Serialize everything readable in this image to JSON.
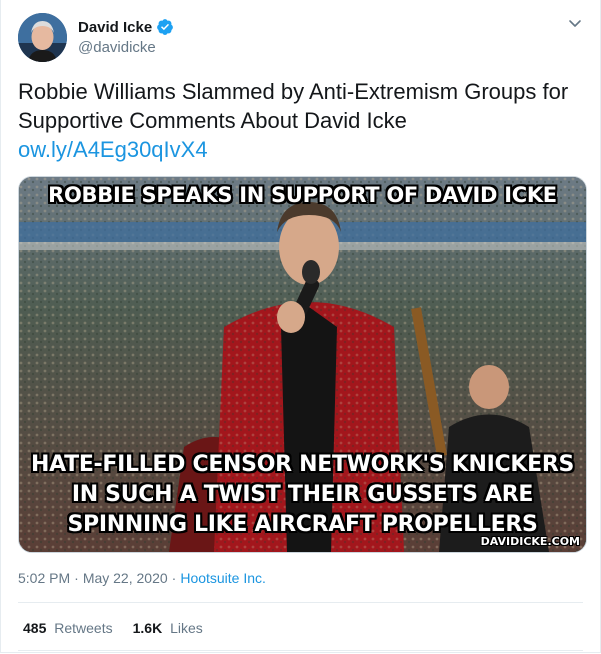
{
  "author": {
    "display_name": "David Icke",
    "handle": "@davidicke",
    "verified": true,
    "avatar_icon": "avatar-photo"
  },
  "tweet": {
    "text": "Robbie Williams Slammed by Anti-Extremism Groups for Supportive Comments About David Icke",
    "link": "ow.ly/A4Eg30qIvX4",
    "time": "5:02 PM",
    "separator1": "·",
    "date": "May 22, 2020",
    "separator2": "·",
    "source": "Hootsuite Inc."
  },
  "media": {
    "caption_top": "ROBBIE SPEAKS IN SUPPORT OF DAVID ICKE",
    "caption_line1": "HATE-FILLED CENSOR NETWORK'S KNICKERS",
    "caption_line2": "IN SUCH A TWIST THEIR GUSSETS ARE",
    "caption_line3": "SPINNING LIKE AIRCRAFT PROPELLERS",
    "watermark": "DAVIDICKE.COM"
  },
  "stats": {
    "retweets_count": "485",
    "retweets_label": "Retweets",
    "likes_count": "1.6K",
    "likes_label": "Likes"
  },
  "colors": {
    "link": "#1b95e0",
    "muted": "#657786",
    "verified": "#1da1f2"
  }
}
